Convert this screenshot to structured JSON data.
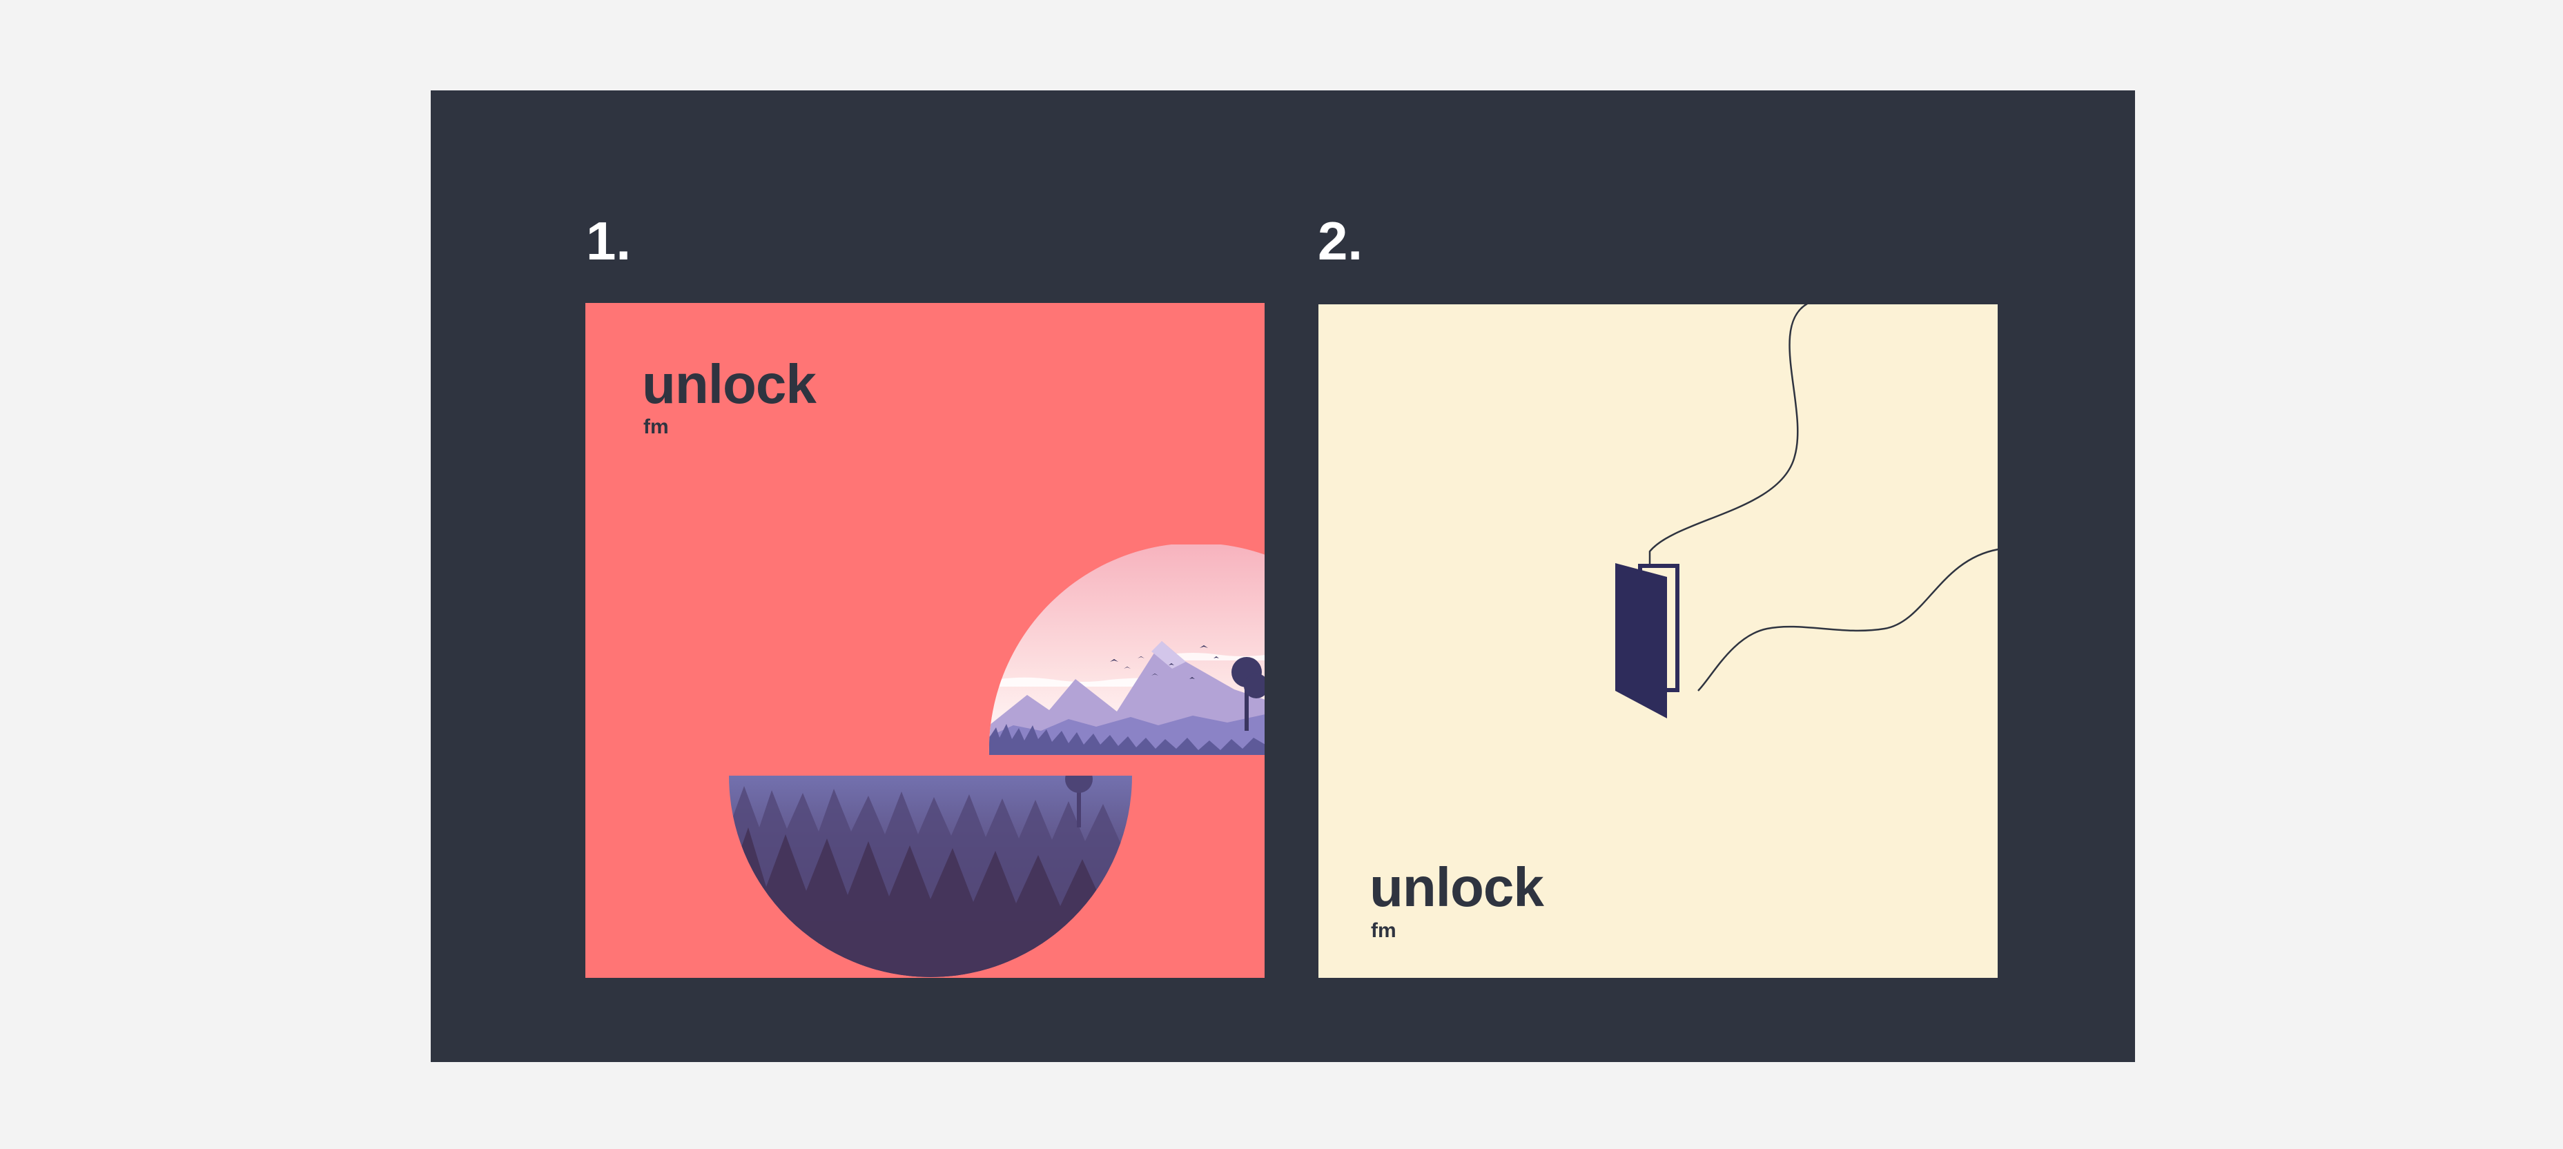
{
  "labels": {
    "option_1": "1.",
    "option_2": "2."
  },
  "cards": [
    {
      "title": "unlock",
      "subtitle": "fm",
      "background": "#ff7575",
      "illustration": "mountain-forest-landscape"
    },
    {
      "title": "unlock",
      "subtitle": "fm",
      "background": "#fcf2d6",
      "illustration": "open-door-with-cables-icon"
    }
  ],
  "colors": {
    "page_background": "#f3f3f3",
    "board_background": "#2f3440",
    "text_dark": "#2f3440",
    "door": "#2e2c5b"
  }
}
